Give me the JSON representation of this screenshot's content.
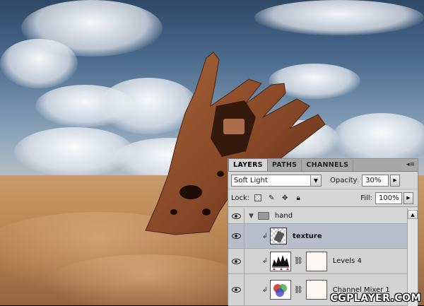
{
  "panel": {
    "tabs": [
      {
        "label": "LAYERS",
        "active": true
      },
      {
        "label": "PATHS",
        "active": false
      },
      {
        "label": "CHANNELS",
        "active": false
      }
    ],
    "menu_icon": "panel-menu-icon",
    "blend_mode": "Soft Light",
    "opacity_label": "Opacity:",
    "opacity_value": "30%",
    "lock_label": "Lock:",
    "lock_icons": [
      "lock-transparent-icon",
      "lock-paint-icon",
      "lock-move-icon",
      "lock-all-icon"
    ],
    "fill_label": "Fill:",
    "fill_value": "100%"
  },
  "layers": [
    {
      "name": "hand",
      "type": "group"
    },
    {
      "name": "texture",
      "type": "pixel",
      "selected": true,
      "clipped": true
    },
    {
      "name": "Levels 4",
      "type": "adjustment",
      "clipped": true
    },
    {
      "name": "Channel Mixer 1",
      "type": "adjustment",
      "clipped": true
    }
  ],
  "watermark": "CGPLAYER.COM",
  "colors": {
    "selected_row": "#b9bdcb",
    "panel_bg": "#d6d6d6",
    "tab_bar": "#a8a8a8"
  }
}
